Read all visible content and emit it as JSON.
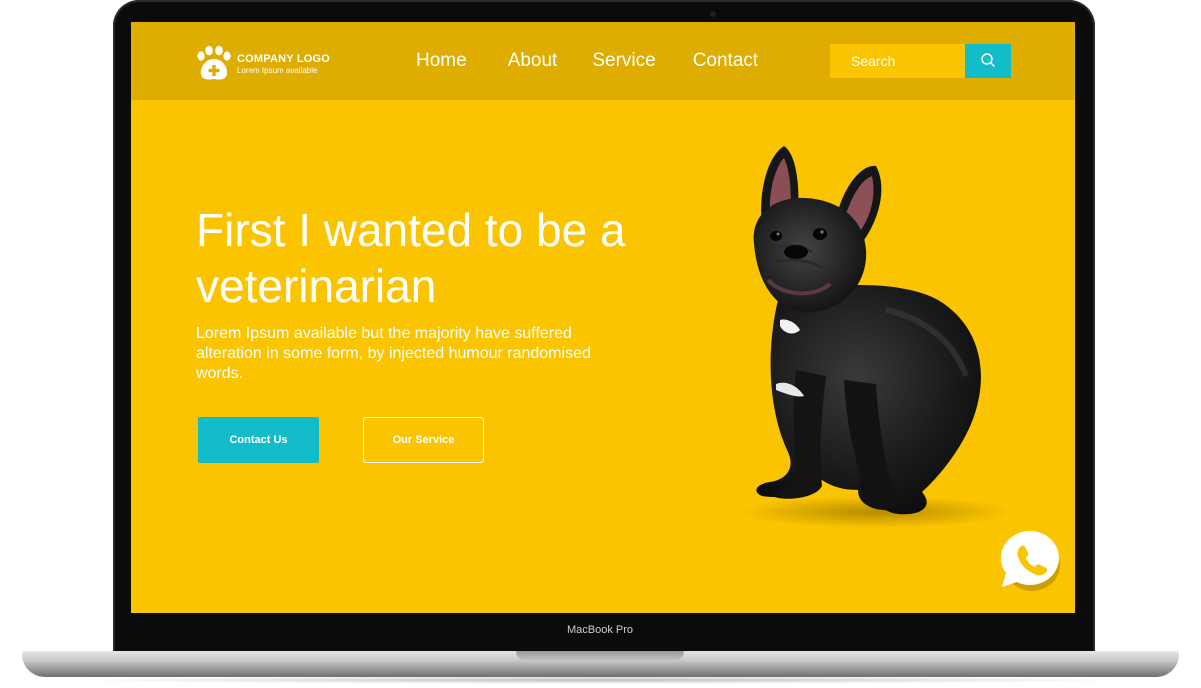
{
  "device": {
    "model_label": "MacBook Pro"
  },
  "header": {
    "logo": {
      "icon": "paw-cross-icon",
      "title": "COMPANY LOGO",
      "subtitle": "Lorem Ipsum available"
    },
    "nav": [
      {
        "label": "Home"
      },
      {
        "label": "About"
      },
      {
        "label": "Service"
      },
      {
        "label": "Contact"
      }
    ],
    "search": {
      "placeholder": "Search",
      "value": "",
      "button_icon": "search-icon"
    }
  },
  "hero": {
    "title": "First I wanted to be a veterinarian",
    "description": "Lorem Ipsum available but the majority have  suffered alteration in some form, by injected  humour randomised words.",
    "primary_button": "Contact Us",
    "secondary_button": "Our Service",
    "image": "french-bulldog-photo"
  },
  "floating": {
    "whatsapp_icon": "whatsapp-icon"
  },
  "colors": {
    "hero_background": "#fbc400",
    "navbar_background": "#dfac00",
    "accent": "#12bcc9",
    "text": "#ffffff"
  }
}
